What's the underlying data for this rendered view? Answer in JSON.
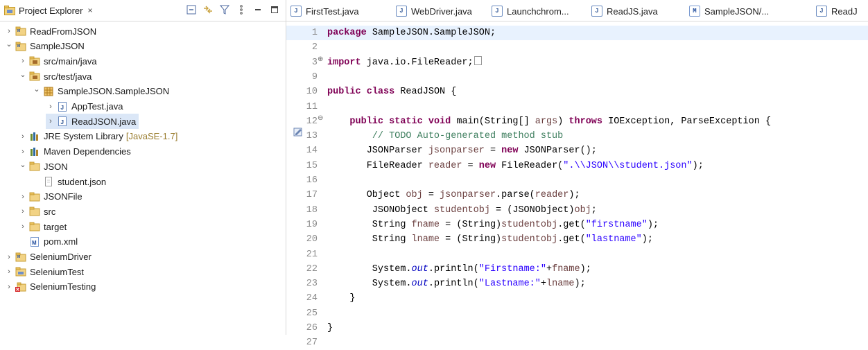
{
  "explorer": {
    "title": "Project Explorer",
    "close": "×",
    "items": [
      {
        "label": "ReadFromJSON",
        "arrow": "›",
        "icon": "maven-project-icon"
      },
      {
        "label": "SampleJSON",
        "arrow": "⌄",
        "icon": "maven-project-icon"
      },
      {
        "label": "src/main/java",
        "arrow": "›",
        "icon": "source-folder-icon"
      },
      {
        "label": "src/test/java",
        "arrow": "⌄",
        "icon": "source-folder-icon"
      },
      {
        "label": "SampleJSON.SampleJSON",
        "arrow": "⌄",
        "icon": "package-icon"
      },
      {
        "label": "AppTest.java",
        "arrow": "›",
        "icon": "java-file-icon"
      },
      {
        "label": "ReadJSON.java",
        "arrow": "›",
        "icon": "java-file-icon"
      },
      {
        "label": "JRE System Library",
        "decoration": "[JavaSE-1.7]",
        "arrow": "›",
        "icon": "library-icon"
      },
      {
        "label": "Maven Dependencies",
        "arrow": "›",
        "icon": "library-icon"
      },
      {
        "label": "JSON",
        "arrow": "⌄",
        "icon": "folder-icon"
      },
      {
        "label": "student.json",
        "arrow": "",
        "icon": "file-icon"
      },
      {
        "label": "JSONFile",
        "arrow": "›",
        "icon": "folder-icon"
      },
      {
        "label": "src",
        "arrow": "›",
        "icon": "folder-icon"
      },
      {
        "label": "target",
        "arrow": "›",
        "icon": "folder-icon"
      },
      {
        "label": "pom.xml",
        "arrow": "",
        "icon": "maven-pom-icon"
      },
      {
        "label": "SeleniumDriver",
        "arrow": "›",
        "icon": "maven-project-icon"
      },
      {
        "label": "SeleniumTest",
        "arrow": "›",
        "icon": "project-icon"
      },
      {
        "label": "SeleniumTesting",
        "arrow": "›",
        "icon": "project-error-icon"
      }
    ]
  },
  "editor": {
    "tabs": [
      {
        "label": "FirstTest.java",
        "icon": "J"
      },
      {
        "label": "WebDriver.java",
        "icon": "J"
      },
      {
        "label": "Launchchrom...",
        "icon": "J"
      },
      {
        "label": "ReadJS.java",
        "icon": "J"
      },
      {
        "label": "SampleJSON/...",
        "icon": "M"
      },
      {
        "label": "ReadJ",
        "icon": "J"
      }
    ],
    "lines": [
      {
        "n": "1",
        "html": "<span class=\"kw\">package</span> SampleJSON.SampleJSON;"
      },
      {
        "n": "2",
        "html": ""
      },
      {
        "n": "3",
        "fold": "⊕",
        "html": "<span class=\"kw\">import</span> java.io.FileReader;<span class=\"box\"></span>"
      },
      {
        "n": "9",
        "html": ""
      },
      {
        "n": "10",
        "html": "<span class=\"kw\">public</span> <span class=\"kw\">class</span> ReadJSON {"
      },
      {
        "n": "11",
        "html": ""
      },
      {
        "n": "12",
        "fold": "⊖",
        "html": "    <span class=\"kw\">public</span> <span class=\"kw\">static</span> <span class=\"kw\">void</span> main(String[] <span class=\"var\">args</span>) <span class=\"kw\">throws</span> IOException, ParseException {"
      },
      {
        "n": "13",
        "html": "        <span class=\"cm\">// TODO Auto-generated method stub</span>"
      },
      {
        "n": "14",
        "html": "       JSONParser <span class=\"var\">jsonparser</span> = <span class=\"kw\">new</span> JSONParser();"
      },
      {
        "n": "15",
        "html": "       FileReader <span class=\"var\">reader</span> = <span class=\"kw\">new</span> FileReader(<span class=\"str\">\".\\\\JSON\\\\student.json\"</span>);"
      },
      {
        "n": "16",
        "html": ""
      },
      {
        "n": "17",
        "html": "       Object <span class=\"var\">obj</span> = <span class=\"var\">jsonparser</span>.parse(<span class=\"var\">reader</span>);"
      },
      {
        "n": "18",
        "html": "        JSONObject <span class=\"var\">studentobj</span> = (JSONObject)<span class=\"var\">obj</span>;"
      },
      {
        "n": "19",
        "html": "        String <span class=\"var\">fname</span> = (String)<span class=\"var\">studentobj</span>.get(<span class=\"str\">\"firstname\"</span>);"
      },
      {
        "n": "20",
        "html": "        String <span class=\"var\">lname</span> = (String)<span class=\"var\">studentobj</span>.get(<span class=\"str\">\"lastname\"</span>);"
      },
      {
        "n": "21",
        "html": ""
      },
      {
        "n": "22",
        "html": "        System.<span class=\"fld\">out</span>.println(<span class=\"str\">\"Firstname:\"</span>+<span class=\"var\">fname</span>);"
      },
      {
        "n": "23",
        "html": "        System.<span class=\"fld\">out</span>.println(<span class=\"str\">\"Lastname:\"</span>+<span class=\"var\">lname</span>);"
      },
      {
        "n": "24",
        "html": "    }"
      },
      {
        "n": "25",
        "html": ""
      },
      {
        "n": "26",
        "html": "}"
      },
      {
        "n": "27",
        "html": ""
      }
    ]
  },
  "colors": {
    "keyword": "#7f0055",
    "string": "#2a00ff",
    "comment": "#3f7f5f",
    "field": "#0000c0",
    "selection": "#dbe7f7"
  }
}
